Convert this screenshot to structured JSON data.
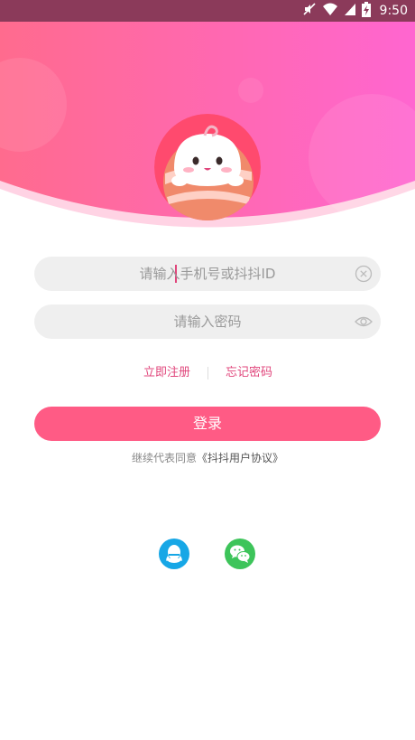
{
  "status_bar": {
    "time": "9:50",
    "icons": [
      "no-sound-icon",
      "wifi-icon",
      "signal-icon",
      "battery-charging-icon"
    ]
  },
  "form": {
    "phone_placeholder": "请输入手机号或抖抖ID",
    "password_placeholder": "请输入密码",
    "clear_icon": "clear-circle-icon",
    "visibility_icon": "eye-icon"
  },
  "links": {
    "register": "立即注册",
    "forgot_password": "忘记密码"
  },
  "login_button": "登录",
  "agreement": {
    "prefix": "继续代表同意",
    "link": "《抖抖用户协议》"
  },
  "social": {
    "qq_icon": "qq-icon",
    "wechat_icon": "wechat-icon"
  },
  "colors": {
    "accent": "#ff5b85",
    "link": "#e0457b",
    "header_gradient_start": "#ff6b8e",
    "header_gradient_end": "#ff66d0",
    "qq": "#17a7e6",
    "wechat": "#3dc45a"
  }
}
